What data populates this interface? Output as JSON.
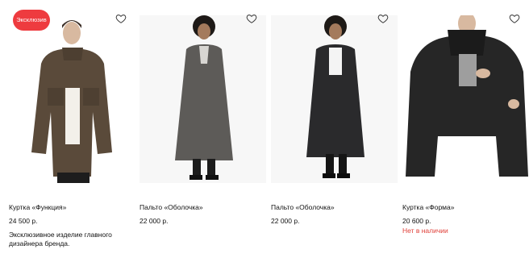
{
  "products": [
    {
      "name": "Куртка «Функция»",
      "price": "24 500 р.",
      "badge": "Эксклюзив",
      "note": "Эксклюзивное изделие главного дизайнера бренда."
    },
    {
      "name": "Пальто «Оболочка»",
      "price": "22 000 р."
    },
    {
      "name": "Пальто «Оболочка»",
      "price": "22 000 р."
    },
    {
      "name": "Куртка «Форма»",
      "price": "20 600 р.",
      "stock": "Нет в наличии"
    }
  ],
  "colors": {
    "badge": "#ee3b3f",
    "out_of_stock": "#e0413a",
    "photo_bg": "#f1f1f1"
  },
  "icons": {
    "favorite": "heart-outline-icon"
  }
}
